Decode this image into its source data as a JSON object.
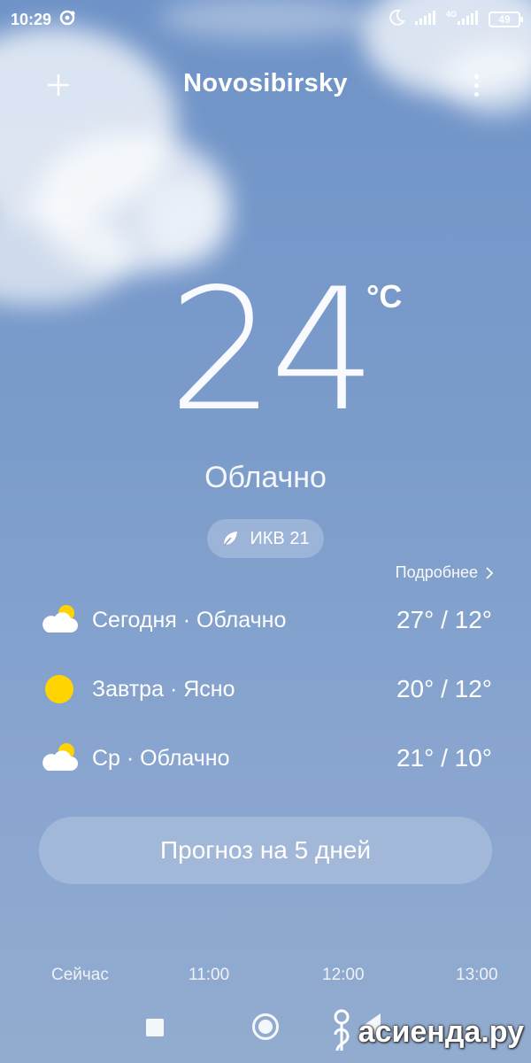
{
  "status_bar": {
    "time": "10:29",
    "network_label": "4G",
    "battery": "49"
  },
  "header": {
    "city": "Novosibirsky"
  },
  "current": {
    "temperature": "24",
    "unit": "°C",
    "condition": "Облачно",
    "aqi_label": "ИКВ 21"
  },
  "details_link": "Подробнее",
  "daily": [
    {
      "label": "Сегодня · Облачно",
      "temps": "27° / 12°",
      "icon": "cloudy-icon"
    },
    {
      "label": "Завтра · Ясно",
      "temps": "20° / 12°",
      "icon": "sun-icon"
    },
    {
      "label": "Ср · Облачно",
      "temps": "21° / 10°",
      "icon": "cloudy-icon"
    }
  ],
  "forecast_button": "Прогноз на 5 дней",
  "hours": [
    "Сейчас",
    "11:00",
    "12:00",
    "13:00"
  ],
  "watermark": "асиенда.ру",
  "colors": {
    "sky_top": "#6f93c8",
    "sky_bottom": "#92accf",
    "sun": "#ffd400"
  }
}
